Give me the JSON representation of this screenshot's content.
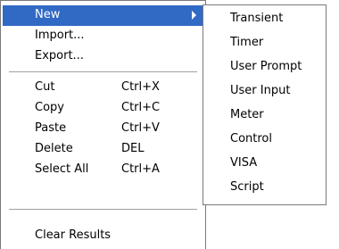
{
  "context_menu": {
    "items": [
      {
        "label": "New",
        "selected": true,
        "has_submenu": true
      },
      {
        "label": "Import..."
      },
      {
        "label": "Export..."
      },
      {
        "label": "Cut",
        "shortcut": "Ctrl+X"
      },
      {
        "label": "Copy",
        "shortcut": "Ctrl+C"
      },
      {
        "label": "Paste",
        "shortcut": "Ctrl+V"
      },
      {
        "label": "Delete",
        "shortcut": "DEL"
      },
      {
        "label": "Select All",
        "shortcut": "Ctrl+A"
      },
      {
        "label": "Clear Results"
      }
    ]
  },
  "submenu": {
    "items": [
      {
        "label": "Transient"
      },
      {
        "label": "Timer"
      },
      {
        "label": "User Prompt"
      },
      {
        "label": "User Input"
      },
      {
        "label": "Meter"
      },
      {
        "label": "Control"
      },
      {
        "label": "VISA"
      },
      {
        "label": "Script"
      }
    ]
  },
  "colors": {
    "selection": "#316ac5",
    "border": "#7a7a7a",
    "separator": "#a0a0a0"
  },
  "icons": {
    "submenu_arrow": "chevron-right-icon"
  }
}
